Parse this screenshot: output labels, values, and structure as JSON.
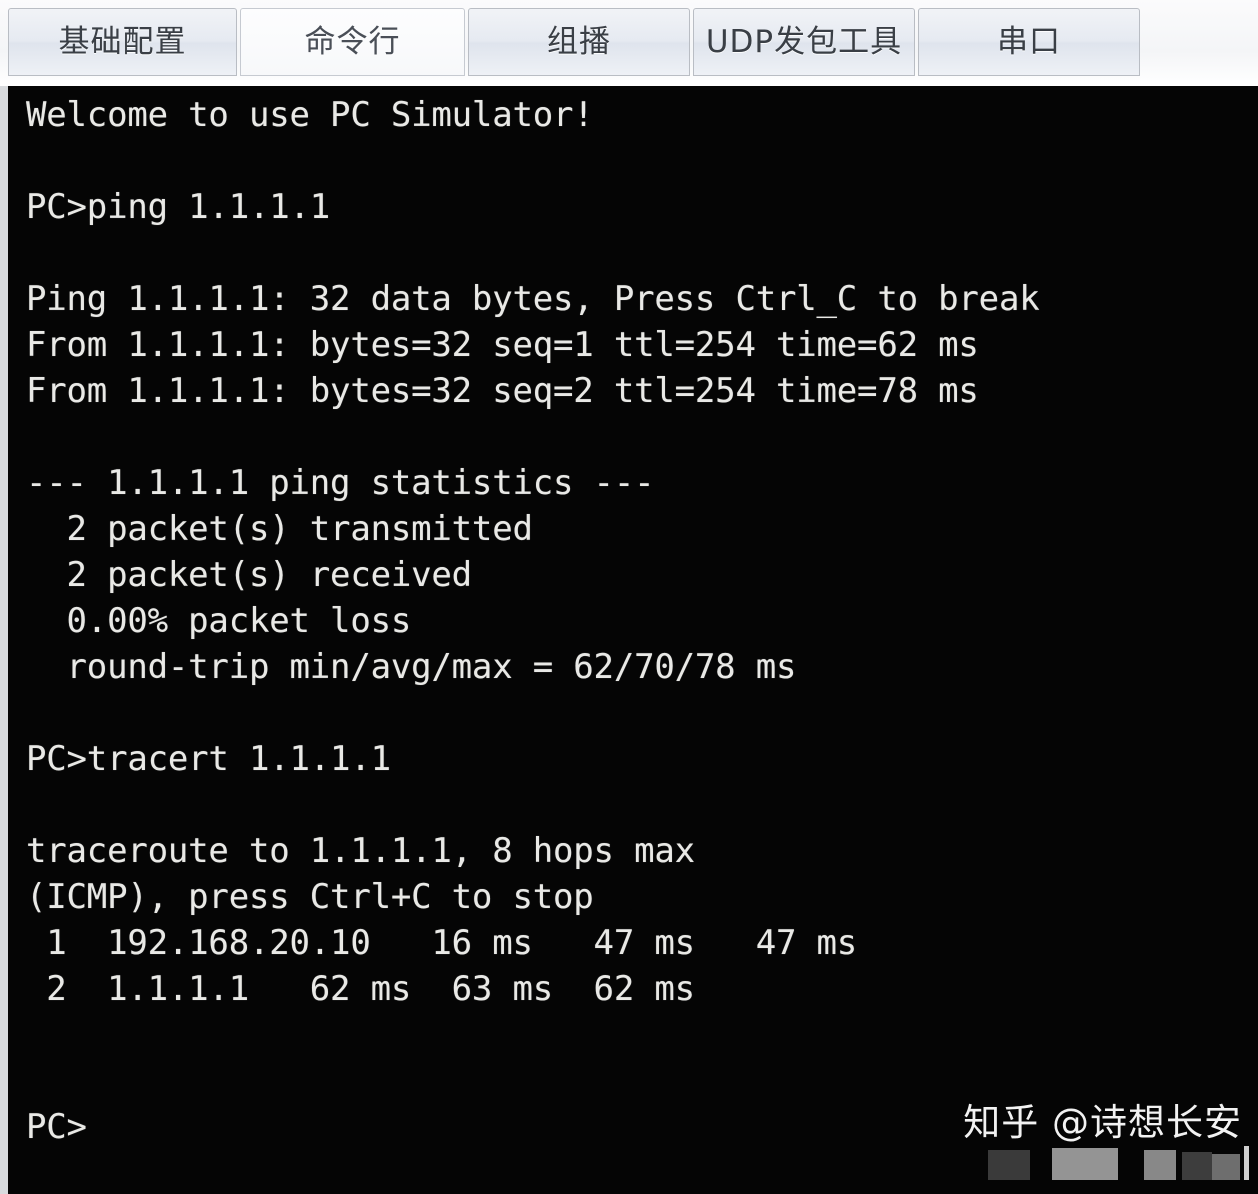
{
  "window": {
    "title": "PC Simulator",
    "terminal_bg": "#050505",
    "terminal_fg": "#e9e9e6",
    "chrome_bg": "#f4f5f7"
  },
  "tabs": [
    {
      "id": "basic-config",
      "label": "基础配置",
      "active": false
    },
    {
      "id": "command-line",
      "label": "命令行",
      "active": true
    },
    {
      "id": "multicast",
      "label": "组播",
      "active": false
    },
    {
      "id": "udp-tool",
      "label": "UDP发包工具",
      "active": false
    },
    {
      "id": "serial-port",
      "label": "串口",
      "active": false
    }
  ],
  "terminal": {
    "banner": "Welcome to use PC Simulator!",
    "prompt": "PC>",
    "commands": [
      {
        "prompt": "PC>",
        "command": "ping 1.1.1.1"
      },
      {
        "prompt": "PC>",
        "command": "tracert 1.1.1.1"
      }
    ],
    "ping": {
      "header": "Ping 1.1.1.1: 32 data bytes, Press Ctrl_C to break",
      "target": "1.1.1.1",
      "data_bytes": "32",
      "replies": [
        "From 1.1.1.1: bytes=32 seq=1 ttl=254 time=62 ms",
        "From 1.1.1.1: bytes=32 seq=2 ttl=254 time=78 ms"
      ],
      "statistics_header": "--- 1.1.1.1 ping statistics ---",
      "statistics": [
        "  2 packet(s) transmitted",
        "  2 packet(s) received",
        "  0.00% packet loss",
        "  round-trip min/avg/max = 62/70/78 ms"
      ],
      "transmitted": "2",
      "received": "2",
      "packet_loss": "0.00%",
      "rtt_min": "62",
      "rtt_avg": "70",
      "rtt_max": "78"
    },
    "tracert": {
      "header_line1": "traceroute to 1.1.1.1, 8 hops max",
      "header_line2": "(ICMP), press Ctrl+C to stop",
      "max_hops": "8",
      "hops": [
        {
          "n": "1",
          "address": "192.168.20.10",
          "t1": "16 ms",
          "t2": "47 ms",
          "t3": "47 ms"
        },
        {
          "n": "2",
          "address": "1.1.1.1",
          "t1": "62 ms",
          "t2": "63 ms",
          "t3": "62 ms"
        }
      ],
      "hop_lines": [
        " 1  192.168.20.10   16 ms   47 ms   47 ms",
        " 2  1.1.1.1   62 ms  63 ms  62 ms"
      ]
    },
    "full_output": "Welcome to use PC Simulator!\n\nPC>ping 1.1.1.1\n\nPing 1.1.1.1: 32 data bytes, Press Ctrl_C to break\nFrom 1.1.1.1: bytes=32 seq=1 ttl=254 time=62 ms\nFrom 1.1.1.1: bytes=32 seq=2 ttl=254 time=78 ms\n\n--- 1.1.1.1 ping statistics ---\n  2 packet(s) transmitted\n  2 packet(s) received\n  0.00% packet loss\n  round-trip min/avg/max = 62/70/78 ms\n\nPC>tracert 1.1.1.1\n\ntraceroute to 1.1.1.1, 8 hops max\n(ICMP), press Ctrl+C to stop\n 1  192.168.20.10   16 ms   47 ms   47 ms\n 2  1.1.1.1   62 ms  63 ms  62 ms\n\n\nPC>"
  },
  "watermark": {
    "text": "知乎 @诗想长安"
  }
}
